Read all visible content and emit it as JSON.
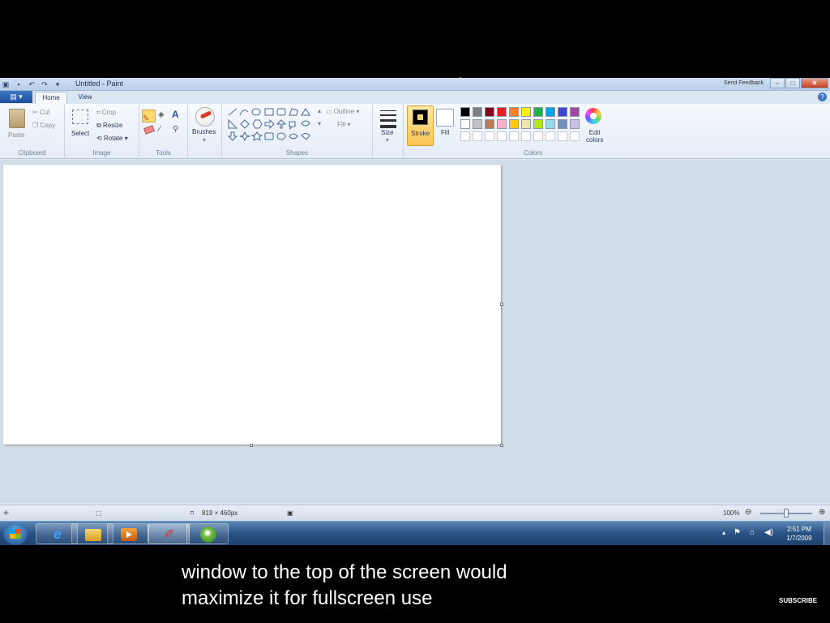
{
  "window": {
    "title": "Untitled - Paint",
    "send_feedback": "Send Feedback",
    "close": "✕",
    "minimize": "–",
    "maximize": "□"
  },
  "tabs": {
    "home": "Home",
    "view": "View"
  },
  "ribbon": {
    "clipboard": {
      "paste": "Paste",
      "cut": "Cut",
      "copy": "Copy",
      "label": "Clipboard"
    },
    "image": {
      "select": "Select",
      "crop": "Crop",
      "resize": "Resize",
      "rotate": "Rotate",
      "label": "Image"
    },
    "tools": {
      "label": "Tools",
      "text_glyph": "A"
    },
    "brushes": {
      "label": "Brushes"
    },
    "shapes": {
      "outline": "Outline",
      "fill": "Fill",
      "label": "Shapes"
    },
    "size": {
      "label": "Size"
    },
    "stroke": {
      "label": "Stroke"
    },
    "fill_color": {
      "label": "Fill"
    },
    "colors": {
      "label": "Colors",
      "edit_line1": "Edit",
      "edit_line2": "colors",
      "row1": [
        "#000000",
        "#7f7f7f",
        "#880015",
        "#ed1c24",
        "#ff7f27",
        "#fff200",
        "#22b14c",
        "#00a2e8",
        "#3f48cc",
        "#a349a4"
      ],
      "row2": [
        "#ffffff",
        "#c3c3c3",
        "#b97a57",
        "#ffaec9",
        "#ffc90e",
        "#efe4b0",
        "#b5e61d",
        "#99d9ea",
        "#7092be",
        "#c8bfe7"
      ]
    }
  },
  "status": {
    "dimensions": "819 × 460px",
    "zoom": "100%"
  },
  "taskbar": {
    "time": "2:51 PM",
    "date": "1/7/2009"
  },
  "caption": {
    "line1": "window to the top of the screen would",
    "line2": "maximize it for fullscreen use"
  },
  "subscribe": "SUBSCRIBE"
}
